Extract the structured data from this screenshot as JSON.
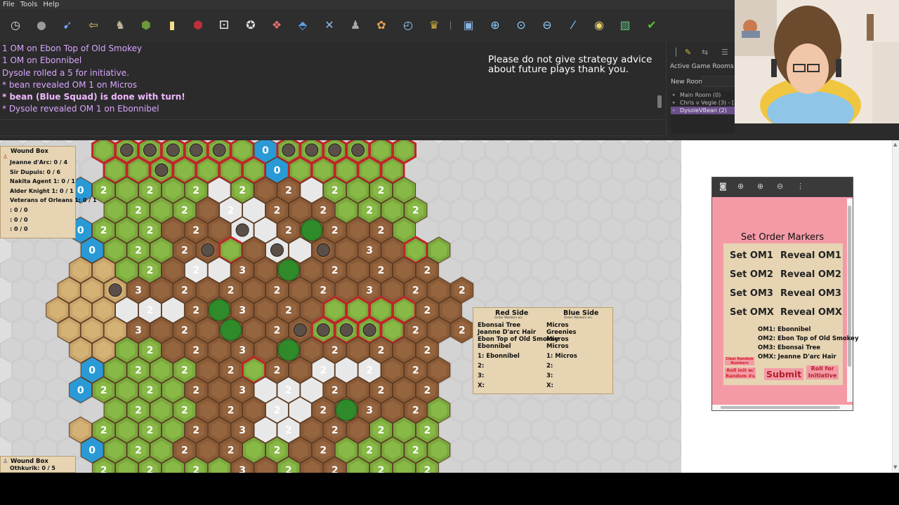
{
  "menu": [
    "File",
    "Tools",
    "Help"
  ],
  "toolbar_icons": [
    {
      "name": "clock-icon",
      "glyph": "◷",
      "color": "#cfe8cf"
    },
    {
      "name": "grey-circle-icon",
      "glyph": "●",
      "color": "#9a9a9a"
    },
    {
      "name": "syringe-icon",
      "glyph": "➹",
      "color": "#6fa8ff"
    },
    {
      "name": "exit-icon",
      "glyph": "⇦",
      "color": "#e8c96a"
    },
    {
      "name": "figure-icon",
      "glyph": "♞",
      "color": "#c4b89a"
    },
    {
      "name": "hex-green-icon",
      "glyph": "⬢",
      "color": "#6e9a3a"
    },
    {
      "name": "note-icon",
      "glyph": "▮",
      "color": "#f4e08a"
    },
    {
      "name": "red-die-icon",
      "glyph": "⬢",
      "color": "#c0303a"
    },
    {
      "name": "white-die-icon",
      "glyph": "⚀",
      "color": "#ffffff"
    },
    {
      "name": "black-d20-icon",
      "glyph": "✪",
      "color": "#dddddd"
    },
    {
      "name": "dice-icon",
      "glyph": "❖",
      "color": "#e36f6f"
    },
    {
      "name": "blue-dice-icon",
      "glyph": "⬘",
      "color": "#5aa0e8"
    },
    {
      "name": "tools-icon",
      "glyph": "✕",
      "color": "#8fb8e8"
    },
    {
      "name": "person-icon",
      "glyph": "♟",
      "color": "#aaaaaa"
    },
    {
      "name": "palette-icon",
      "glyph": "✿",
      "color": "#e0a050"
    },
    {
      "name": "timer-icon",
      "glyph": "◴",
      "color": "#8fd0ff"
    },
    {
      "name": "trophy-icon",
      "glyph": "♛",
      "color": "#d6b040"
    },
    {
      "name": "camera-icon",
      "glyph": "▣",
      "color": "#8ab4e0"
    },
    {
      "name": "zoom-in-icon",
      "glyph": "⊕",
      "color": "#8fd0ff"
    },
    {
      "name": "zoom-icon",
      "glyph": "⊙",
      "color": "#8fd0ff"
    },
    {
      "name": "zoom-out-icon",
      "glyph": "⊖",
      "color": "#8fd0ff"
    },
    {
      "name": "line-icon",
      "glyph": "⁄",
      "color": "#8fd0ff"
    },
    {
      "name": "eye-icon",
      "glyph": "◉",
      "color": "#e8d070"
    },
    {
      "name": "map-icon",
      "glyph": "▧",
      "color": "#60c080"
    },
    {
      "name": "checkmark-icon",
      "glyph": "✔",
      "color": "#5ac030"
    }
  ],
  "chat": {
    "lines": [
      {
        "text": "1 OM on Ebon Top of Old Smokey",
        "bold": false
      },
      {
        "text": "1 OM on Ebonnibel",
        "bold": false
      },
      {
        "text": "Dysole rolled a 5 for initiative.",
        "bold": false
      },
      {
        "text": "* bean revealed OM 1 on Micros",
        "bold": false
      },
      {
        "text": "* bean (Blue Squad) is done with turn!",
        "bold": true
      },
      {
        "text": "* Dysole revealed OM 1 on Ebonnibel",
        "bold": false
      }
    ],
    "notice": "Please do not give strategy advice about future plays thank you."
  },
  "rooms": {
    "header": "Active Game Rooms",
    "new_room_label": "New Room",
    "items": [
      {
        "label": "Main Room (0)",
        "selected": false
      },
      {
        "label": "Chris v Vegie (3) - [3...",
        "selected": false
      },
      {
        "label": "DysoleVBean (2)",
        "selected": true
      }
    ]
  },
  "wound_box_1": {
    "title": "Wound Box",
    "lines": [
      "Jeanne d'Arc: 0 / 4",
      "Sir Dupuis: 0 / 6",
      "Nakita Agent 1: 0 / 1",
      "Alder Knight 1: 0 / 1",
      "Veterans of Orleans 1: 0 / 1",
      ": 0 / 0",
      ": 0 / 0",
      ": 0 / 0"
    ]
  },
  "wound_box_2": {
    "title": "Wound Box",
    "lines": [
      "Othkurik: 0 / 5"
    ]
  },
  "orders_card": {
    "red": {
      "title": "Red Side",
      "sub": "Order Markers on:",
      "units": [
        "Ebonsai Tree",
        "Jeanne D'arc Hair",
        "Ebon Top of Old Smokey",
        "Ebonnibel"
      ],
      "slots": [
        "1: Ebonnibel",
        "2:",
        "3:",
        "X:"
      ]
    },
    "blue": {
      "title": "Blue Side",
      "sub": "Order Markers on:",
      "units": [
        "Micros",
        "Greenies",
        "Micros",
        "Micros"
      ],
      "slots": [
        "1: Micros",
        "2:",
        "3:",
        "X:"
      ]
    }
  },
  "om_panel": {
    "title": "Set Order Markers",
    "set_buttons": [
      "Set OM1",
      "Set OM2",
      "Set OM3",
      "Set OMX"
    ],
    "reveal_buttons": [
      "Reveal OM1",
      "Reveal OM2",
      "Reveal OM3",
      "Reveal OMX"
    ],
    "assignments": [
      "OM1: Ebonnibel",
      "OM2: Ebon Top of Old Smokey",
      "OM3: Ebonsai Tree",
      "OMX: Jeanne D'arc Hair"
    ],
    "clear_random": "Clear Random Numbers",
    "roll_init_random": "Roll init w/ Random #s",
    "submit": "Submit",
    "roll_initiative": "Roll for Initiative"
  },
  "colors": {
    "chat_text": "#d9a6ff",
    "panel_pink": "#f49aa6",
    "parchment": "#e6d4b3",
    "hex_green": "#7aa83c",
    "hex_brown": "#8a5a36",
    "hex_red": "#c0242a",
    "hex_blue": "#2a9ad6",
    "hex_grey": "#d0d0d0"
  }
}
